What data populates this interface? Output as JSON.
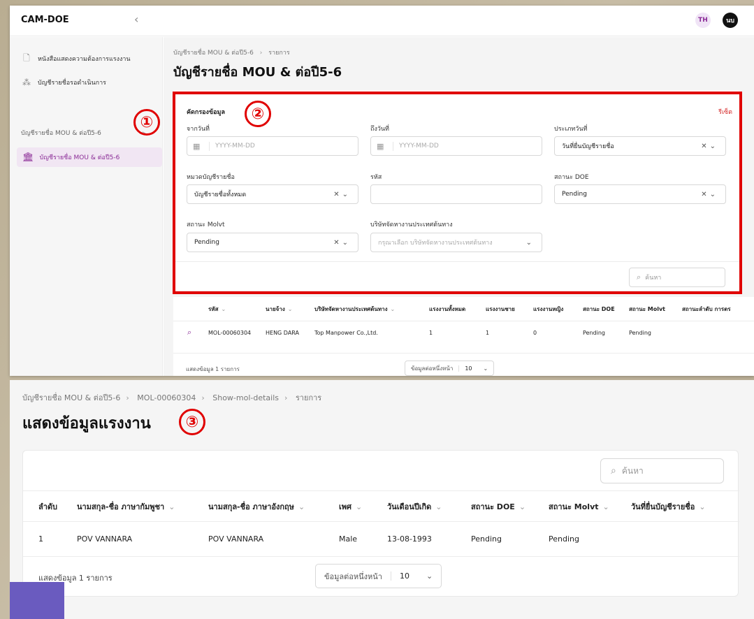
{
  "app": {
    "name": "CAM-DOE",
    "avatars": [
      "TH",
      "นบ"
    ]
  },
  "sidebar": {
    "items": [
      {
        "label": "หนังสือแสดงความต้องการแรงงาน",
        "icon": "document-icon"
      },
      {
        "label": "บัญชีรายชื่อรอดำเนินการ",
        "icon": "users-icon"
      }
    ],
    "group_label": "บัญชีรายชื่อ MOU & ต่อปี5-6",
    "active_item": {
      "label": "บัญชีรายชื่อ MOU & ต่อปี5-6",
      "icon": "bank-icon"
    }
  },
  "list_page": {
    "breadcrumb": [
      "บัญชีรายชื่อ MOU & ต่อปี5-6",
      "รายการ"
    ],
    "title": "บัญชีรายชื่อ MOU & ต่อปี5-6",
    "filter": {
      "title": "คัดกรองข้อมูล",
      "reset_label": "รีเซ็ต",
      "from_date": {
        "label": "จากวันที่",
        "placeholder": "YYYY-MM-DD"
      },
      "to_date": {
        "label": "ถึงวันที่",
        "placeholder": "YYYY-MM-DD"
      },
      "date_type": {
        "label": "ประเภทวันที่",
        "value": "วันที่ยื่นบัญชีรายชื่อ"
      },
      "category": {
        "label": "หมวดบัญชีรายชื่อ",
        "value": "บัญชีรายชื่อทั้งหมด"
      },
      "code": {
        "label": "รหัส",
        "value": ""
      },
      "doe_status": {
        "label": "สถานะ DOE",
        "value": "Pending"
      },
      "molvt_status": {
        "label": "สถานะ Molvt",
        "value": "Pending"
      },
      "agency": {
        "label": "บริษัทจัดหางานประเทศต้นทาง",
        "placeholder": "กรุณาเลือก บริษัทจัดหางานประเทศต้นทาง"
      },
      "search_placeholder": "ค้นหา"
    },
    "table": {
      "headers": [
        "รหัส",
        "นายจ้าง",
        "บริษัทจัดหางานประเทศต้นทาง",
        "แรงงานทั้งหมด",
        "แรงงานชาย",
        "แรงงานหญิง",
        "สถานะ DOE",
        "สถานะ Molvt",
        "สถานะลำดับ การตร"
      ],
      "rows": [
        [
          "MOL-00060304",
          "HENG DARA",
          "Top Manpower Co.,Ltd.",
          "1",
          "1",
          "0",
          "Pending",
          "Pending",
          ""
        ]
      ],
      "footer": "แสดงข้อมูล 1 รายการ",
      "per_page_label": "ข้อมูลต่อหนึ่งหน้า",
      "per_page_value": "10"
    }
  },
  "detail_page": {
    "breadcrumb": [
      "บัญชีรายชื่อ MOU & ต่อปี5-6",
      "MOL-00060304",
      "Show-mol-details",
      "รายการ"
    ],
    "title": "แสดงข้อมูลแรงงาน",
    "search_placeholder": "ค้นหา",
    "table": {
      "headers": [
        "ลำดับ",
        "นามสกุล-ชื่อ ภาษากัมพูชา",
        "นามสกุล-ชื่อ ภาษาอังกฤษ",
        "เพศ",
        "วันเดือนปีเกิด",
        "สถานะ DOE",
        "สถานะ Molvt",
        "วันที่ยื่นบัญชีรายชื่อ"
      ],
      "rows": [
        [
          "1",
          "POV VANNARA",
          "POV VANNARA",
          "Male",
          "13-08-1993",
          "Pending",
          "Pending",
          ""
        ]
      ],
      "footer": "แสดงข้อมูล 1 รายการ",
      "per_page_label": "ข้อมูลต่อหนึ่งหน้า",
      "per_page_value": "10"
    }
  },
  "annotations": [
    "①",
    "②",
    "③"
  ],
  "colors": {
    "accent": "#8a2b96",
    "annotation": "#e00000",
    "reset": "#d52b2b"
  }
}
